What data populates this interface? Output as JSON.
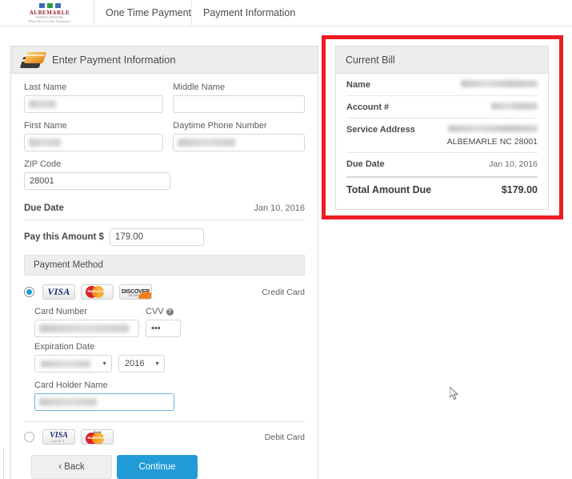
{
  "brand": {
    "logo_word": "ALBEMARLE",
    "logo_sub": "NORTH CAROLINA",
    "logo_tag": "Where We Love Our Community"
  },
  "nav": {
    "tabs": [
      {
        "label": "One Time Payment"
      },
      {
        "label": "Payment Information"
      }
    ]
  },
  "form": {
    "header_title": "Enter Payment Information",
    "fields": {
      "last_name": {
        "label": "Last Name",
        "value": ""
      },
      "middle_name": {
        "label": "Middle Name",
        "value": ""
      },
      "first_name": {
        "label": "First Name",
        "value": ""
      },
      "daytime_phone": {
        "label": "Daytime Phone Number",
        "value": ""
      },
      "zip_code": {
        "label": "ZIP Code",
        "value": "28001"
      }
    },
    "due_date": {
      "label": "Due Date",
      "value": "Jan 10, 2016"
    },
    "pay_amount": {
      "label": "Pay this Amount $",
      "value": "179.00"
    },
    "payment_method": {
      "header": "Payment Method",
      "credit": {
        "tag": "Credit Card",
        "selected": true,
        "brands": [
          "VISA",
          "MasterCard",
          "DISCOVER"
        ]
      },
      "debit": {
        "tag": "Debit Card",
        "selected": false,
        "brands": [
          "VISA DEBIT",
          "Debit MasterCard"
        ]
      }
    },
    "card": {
      "card_number": {
        "label": "Card Number",
        "value": ""
      },
      "cvv": {
        "label": "CVV",
        "value": "•••"
      },
      "expiration": {
        "label": "Expiration Date",
        "month": "",
        "year": "2016"
      },
      "holder_name": {
        "label": "Card Holder Name",
        "value": ""
      }
    },
    "buttons": {
      "back": "‹  Back",
      "continue": "Continue"
    }
  },
  "bill": {
    "title": "Current Bill",
    "rows": [
      {
        "key": "Name",
        "value": "",
        "redacted": true
      },
      {
        "key": "Account #",
        "value": "",
        "redacted": true
      },
      {
        "key": "Service Address",
        "value": "",
        "redacted": true,
        "line2": "ALBEMARLE NC 28001"
      },
      {
        "key": "Due Date",
        "value": "Jan 10, 2016",
        "redacted": false
      }
    ],
    "total": {
      "label": "Total Amount Due",
      "value": "$179.00"
    }
  },
  "colors": {
    "accent_blue": "#229cd8",
    "highlight_red": "#ed1c24",
    "panel_header_gray": "#ededed"
  }
}
